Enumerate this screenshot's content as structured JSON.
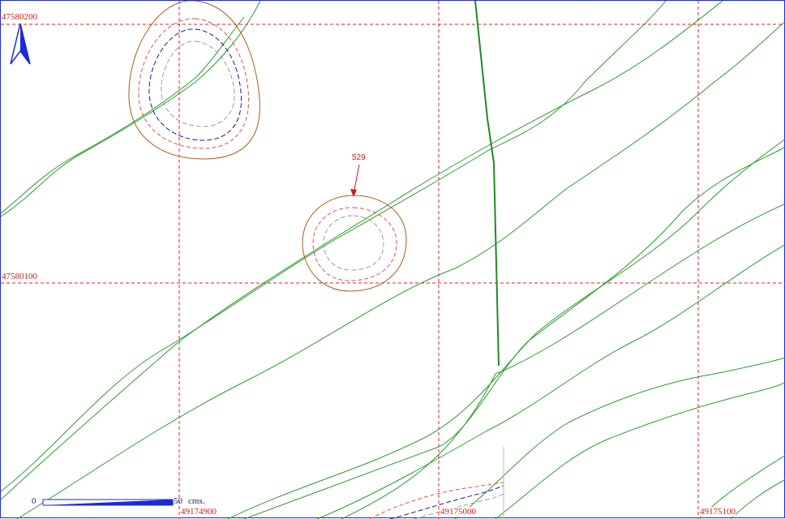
{
  "map": {
    "grid_y_labels": [
      "47580200",
      "47580100"
    ],
    "grid_x_labels": [
      "49174900",
      "49175000",
      "49175100"
    ],
    "point_label": "529",
    "scale_bar": {
      "start_label": "0",
      "end_label": "50",
      "unit_label": "cms."
    },
    "north_arrow_icon": "north-arrow-icon",
    "colors": {
      "grid": "#e02020",
      "contour_outer": "#b05a1a",
      "contour_inner": "#e05050",
      "contour_dashed_blue": "#1a1a8e",
      "contour_gray": "#9a9aaa",
      "network_lines": "#2e9a2e",
      "frame": "#1e2bd6"
    }
  }
}
